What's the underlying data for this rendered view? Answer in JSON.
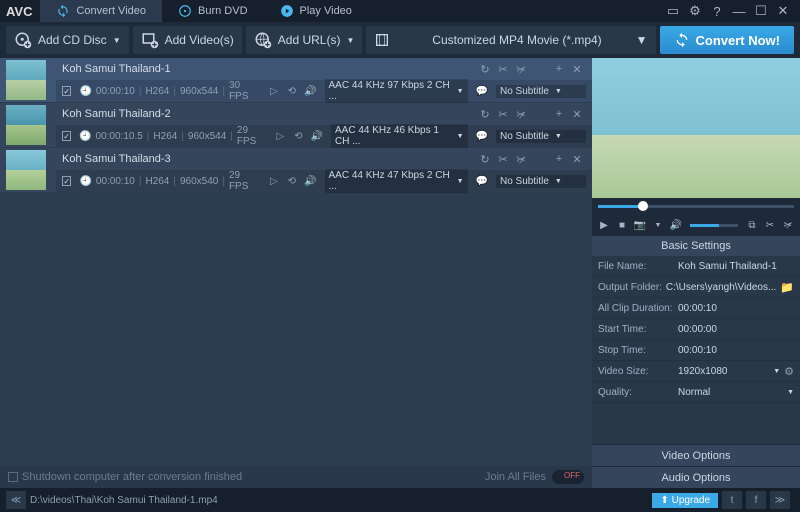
{
  "app": {
    "logo": "AVC"
  },
  "tabs": [
    {
      "label": "Convert Video"
    },
    {
      "label": "Burn DVD"
    },
    {
      "label": "Play Video"
    }
  ],
  "toolbar": {
    "add_cd": "Add CD Disc",
    "add_videos": "Add Video(s)",
    "add_urls": "Add URL(s)",
    "profile": "Customized MP4 Movie (*.mp4)",
    "convert": "Convert Now!"
  },
  "items": [
    {
      "title": "Koh Samui Thailand-1",
      "duration": "00:00:10",
      "codec": "H264",
      "res": "960x544",
      "fps": "30 FPS",
      "audio": "AAC 44 KHz 97 Kbps 2 CH ...",
      "subtitle": "No Subtitle"
    },
    {
      "title": "Koh Samui Thailand-2",
      "duration": "00:00:10.5",
      "codec": "H264",
      "res": "960x544",
      "fps": "29 FPS",
      "audio": "AAC 44 KHz 46 Kbps 1 CH ...",
      "subtitle": "No Subtitle"
    },
    {
      "title": "Koh Samui Thailand-3",
      "duration": "00:00:10",
      "codec": "H264",
      "res": "960x540",
      "fps": "29 FPS",
      "audio": "AAC 44 KHz 47 Kbps 2 CH ...",
      "subtitle": "No Subtitle"
    }
  ],
  "list_bottom": {
    "shutdown": "Shutdown computer after conversion finished",
    "join": "Join All Files"
  },
  "settings": {
    "header": "Basic Settings",
    "rows": {
      "filename_lbl": "File Name:",
      "filename_val": "Koh Samui Thailand-1",
      "output_lbl": "Output Folder:",
      "output_val": "C:\\Users\\yangh\\Videos...",
      "allclip_lbl": "All Clip Duration:",
      "allclip_val": "00:00:10",
      "start_lbl": "Start Time:",
      "start_val": "00:00:00",
      "stop_lbl": "Stop Time:",
      "stop_val": "00:00:10",
      "vsize_lbl": "Video Size:",
      "vsize_val": "1920x1080",
      "quality_lbl": "Quality:",
      "quality_val": "Normal"
    },
    "video_options": "Video Options",
    "audio_options": "Audio Options"
  },
  "status": {
    "path": "D:\\videos\\Thai\\Koh Samui Thailand-1.mp4",
    "upgrade": "Upgrade"
  }
}
